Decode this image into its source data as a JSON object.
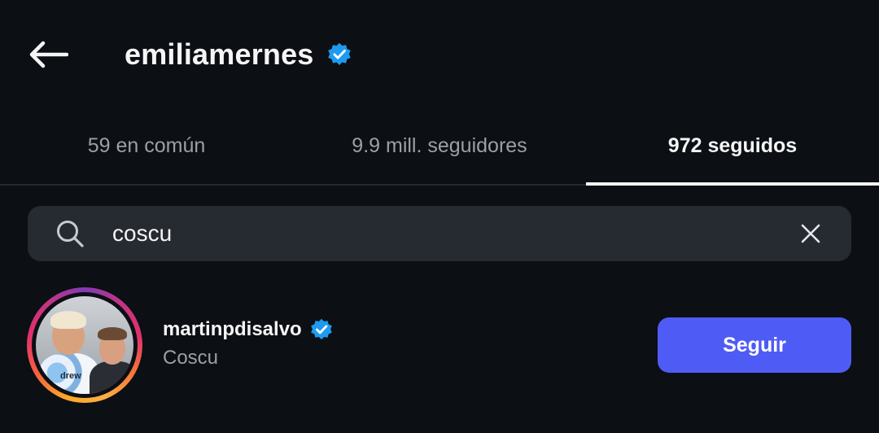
{
  "header": {
    "title": "emiliamernes",
    "back_icon": "arrow-left-icon",
    "verified_icon": "verified-badge-icon"
  },
  "tabs": [
    {
      "label": "59 en común",
      "active": false
    },
    {
      "label": "9.9 mill. seguidores",
      "active": false
    },
    {
      "label": "972 seguidos",
      "active": true
    }
  ],
  "search": {
    "value": "coscu",
    "icon": "search-icon",
    "clear_icon": "close-icon"
  },
  "results": [
    {
      "username": "martinpdisalvo",
      "full_name": "Coscu",
      "verified": true,
      "follow_label": "Seguir",
      "avatar_shirt_text": "drew"
    }
  ],
  "colors": {
    "background": "#0c0f14",
    "search_bg": "#262a31",
    "follow_button": "#4f5bf5",
    "verified": "#1d9bf0",
    "muted_text": "#9aa0a7"
  }
}
